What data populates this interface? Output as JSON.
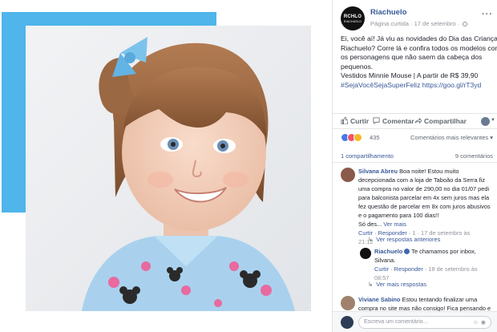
{
  "post": {
    "page_name": "Riachuelo",
    "avatar_text": "RCHLO",
    "avatar_sub": "RIACHUELO",
    "meta": "Página curtida · 17 de setembro ·",
    "text_lines": [
      "Ei, você aí! Já viu as novidades do Dia das Crianças",
      "Riachuelo? Corre lá e confira todos os modelos com",
      "os personagens que não saem da cabeça dos",
      "pequenos.",
      "Vestidos Minnie Mouse | A partir de R$ 39,90"
    ],
    "hashtag_line": "#SejaVocêSejaSuperFeliz https://goo.gl/rT3yd"
  },
  "actions": {
    "like": "Curtir",
    "comment": "Comentar",
    "share": "Compartilhar"
  },
  "reactions": {
    "count": "435",
    "sort_label": "Comentários mais relevantes ▾",
    "shares": "1 compartilhamento",
    "comments": "9 comentários",
    "colors": {
      "like": "#4a76e8",
      "love": "#f25268",
      "wow": "#f7b928"
    }
  },
  "comments": [
    {
      "name": "Silvana Abreu",
      "lines": [
        " Boa noite! Estou muito",
        "decepcionada com a loja de Taboão da Serra fiz",
        "uma compra no valor de 290,00 no dia 01/07 pedi",
        "para balconista parcelar em 4x sem juros mas ela",
        "fez questão de parcelar em 8x com juros abusivos",
        "e o pagamento para 100 dias!!",
        "Só des..."
      ],
      "see_more": "Ver mais",
      "meta_actions": "Curtir · Responder ·",
      "meta_time": "1 · 17 de setembro às",
      "meta_time2": "21:12",
      "older_replies": "Ver respostas anteriores"
    },
    {
      "name": "Riachuelo",
      "lines": [
        " Te chamamos por inbox,",
        "Silvana."
      ],
      "meta_actions": "Curtir · Responder ·",
      "meta_time": "18 de setembro às",
      "meta_time2": "08:57",
      "more_replies": "Ver mais respostas"
    },
    {
      "name": "Viviane Sabino",
      "lines": [
        " Estou tentando finalizar uma",
        "compra no site mas não consigo! Fica pensando e"
      ]
    }
  ],
  "composer": {
    "placeholder": "Escreva um comentário..."
  }
}
